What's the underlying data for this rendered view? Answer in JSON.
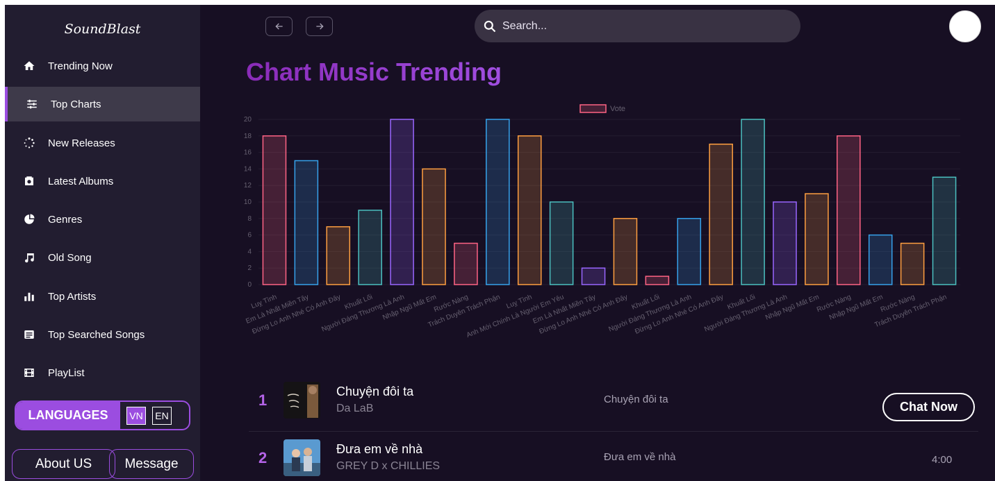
{
  "app": {
    "logo": "SoundBlast"
  },
  "sidebar": {
    "items": [
      {
        "label": "Trending Now",
        "icon": "home-icon"
      },
      {
        "label": "Top Charts",
        "icon": "sliders-icon",
        "active": true
      },
      {
        "label": "New Releases",
        "icon": "spinner-icon"
      },
      {
        "label": "Latest Albums",
        "icon": "album-icon"
      },
      {
        "label": "Genres",
        "icon": "genres-icon"
      },
      {
        "label": "Old Song",
        "icon": "music-note-icon"
      },
      {
        "label": "Top Artists",
        "icon": "bar-chart-icon"
      },
      {
        "label": "Top Searched Songs",
        "icon": "search-list-icon"
      },
      {
        "label": "PlayList",
        "icon": "film-icon"
      }
    ],
    "languages": {
      "label": "LANGUAGES",
      "options": [
        "VN",
        "EN"
      ],
      "selected": "VN"
    },
    "footer": {
      "about": "About US",
      "message": "Message"
    }
  },
  "header": {
    "search_placeholder": "Search..."
  },
  "main": {
    "title": "Chart Music Trending"
  },
  "chart_data": {
    "type": "bar",
    "legend": "Vote",
    "legend_position": "top-center",
    "ylim": [
      0,
      20
    ],
    "yticks": [
      0,
      2,
      4,
      6,
      8,
      10,
      12,
      14,
      16,
      18,
      20
    ],
    "grid": true,
    "categories": [
      "Luỵ Tình",
      "Em Là Nhất Miền Tây",
      "Đừng Lo Anh Nhé Có Anh Đây",
      "Khuất Lối",
      "Người Đáng Thương Là Anh",
      "Nhập Ngũ Mất Em",
      "Rước Nàng",
      "Trách Duyên Trách Phận",
      "Luỵ Tình",
      "Anh Mới Chính Là Người Em Yêu",
      "Em Là Nhất Miền Tây",
      "Đừng Lo Anh Nhé Có Anh Đây",
      "Khuất Lối",
      "Người Đáng Thương Là Anh",
      "Đừng Lo Anh Nhé Có Anh Đây",
      "Khuất Lối",
      "Người Đáng Thương Là Anh",
      "Nhập Ngũ Mất Em",
      "Rước Nàng",
      "Nhập Ngũ Mất Em",
      "Rước Nàng",
      "Trách Duyên Trách Phận"
    ],
    "values": [
      18,
      15,
      7,
      9,
      20,
      14,
      5,
      20,
      18,
      10,
      2,
      8,
      1,
      8,
      17,
      20,
      10,
      11,
      18,
      6,
      5,
      13
    ],
    "colors": [
      "#ff6384",
      "#36a2eb",
      "#ff9f40",
      "#4bc0c0",
      "#9966ff",
      "#ff9f40",
      "#ff6384",
      "#36a2eb",
      "#ff9f40",
      "#4bc0c0",
      "#9966ff",
      "#ff9f40",
      "#ff6384",
      "#36a2eb",
      "#ff9f40",
      "#4bc0c0",
      "#9966ff",
      "#ff9f40",
      "#ff6384",
      "#36a2eb",
      "#ff9f40",
      "#4bc0c0"
    ]
  },
  "songs": [
    {
      "rank": "1",
      "title": "Chuyện đôi ta",
      "artist": "Da LaB",
      "album": "Chuyện đôi ta",
      "action": "Chat Now"
    },
    {
      "rank": "2",
      "title": "Đưa em về nhà",
      "artist": "GREY D x CHILLIES",
      "album": "Đưa em về nhà",
      "duration": "4:00"
    }
  ]
}
